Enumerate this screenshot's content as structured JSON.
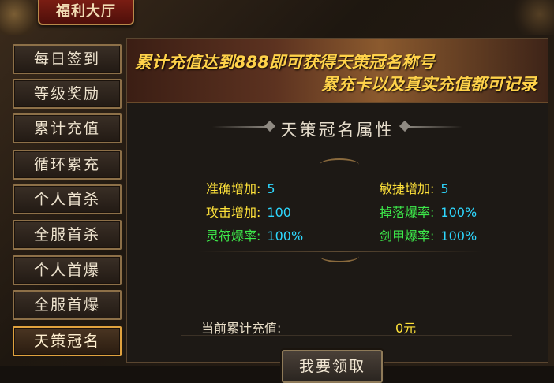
{
  "window": {
    "title": "福利大厅"
  },
  "sidebar": {
    "items": [
      {
        "label": "每日签到"
      },
      {
        "label": "等级奖励"
      },
      {
        "label": "累计充值"
      },
      {
        "label": "循环累充"
      },
      {
        "label": "个人首杀"
      },
      {
        "label": "全服首杀"
      },
      {
        "label": "个人首爆"
      },
      {
        "label": "全服首爆"
      },
      {
        "label": "天策冠名"
      }
    ],
    "active_index": 8
  },
  "banner": {
    "line1": "累计充值达到888即可获得天策冠名称号",
    "line2": "累充卡以及真实充值都可记录"
  },
  "section": {
    "title": "天策冠名属性"
  },
  "attributes": [
    {
      "label": "准确增加:",
      "value": "5"
    },
    {
      "label": "敏捷增加:",
      "value": "5"
    },
    {
      "label": "攻击增加:",
      "value": "100"
    },
    {
      "label": "掉落爆率:",
      "value": "100%"
    },
    {
      "label": "灵符爆率:",
      "value": "100%"
    },
    {
      "label": "剑甲爆率:",
      "value": "100%"
    }
  ],
  "total": {
    "label": "当前累计充值:",
    "value": "0元"
  },
  "claim_button": {
    "label": "我要领取"
  },
  "colors": {
    "accent_gold": "#ffd24a",
    "value_cyan": "#2ed8ff",
    "label_yellow": "#ffe23a",
    "label_green": "#3de84a"
  }
}
